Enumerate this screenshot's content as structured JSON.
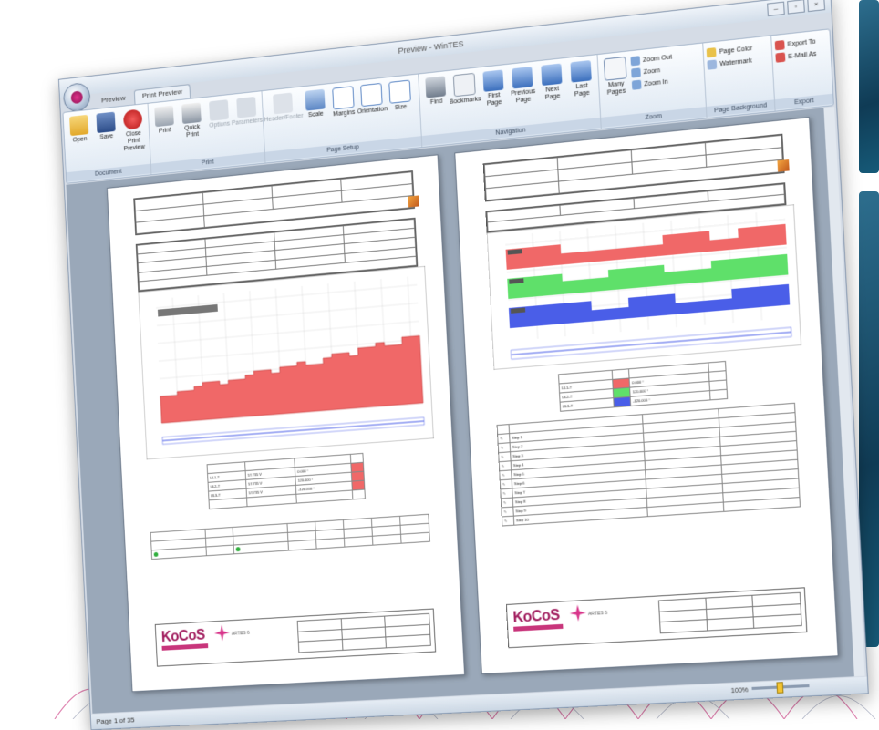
{
  "window": {
    "title": "Preview - WinTES",
    "buttons": [
      "–",
      "▫",
      "×"
    ]
  },
  "ribbon": {
    "tabs": [
      "Preview",
      "Print Preview"
    ],
    "groups": [
      {
        "label": "Document",
        "buttons": [
          "Open",
          "Save",
          "Close Print Preview"
        ]
      },
      {
        "label": "Print",
        "buttons": [
          "Print",
          "Quick Print",
          "Options",
          "Parameters"
        ]
      },
      {
        "label": "Page Setup",
        "buttons": [
          "Header/Footer",
          "Scale",
          "Margins",
          "Orientation",
          "Size"
        ]
      },
      {
        "label": "Navigation",
        "buttons": [
          "Find",
          "Bookmarks",
          "First Page",
          "Previous Page",
          "Next Page",
          "Last Page"
        ]
      },
      {
        "label": "Zoom",
        "buttons": [
          "Many Pages",
          "Zoom Out",
          "Zoom",
          "Zoom In"
        ]
      },
      {
        "label": "Page Background",
        "buttons": [
          "Page Color",
          "Watermark"
        ]
      },
      {
        "label": "Export",
        "buttons": [
          "Export To",
          "E-Mail As"
        ]
      }
    ]
  },
  "status": {
    "page": "Page 1 of 35",
    "zoom": "100%"
  },
  "colors": {
    "red": "#f06868",
    "green": "#5fe06a",
    "blue": "#4a5ee8",
    "brand": "#a01a5c"
  },
  "page_left": {
    "signals": [
      {
        "name": "UL1-T",
        "value": "57.735 V",
        "angle": "0.000 °"
      },
      {
        "name": "UL2-T",
        "value": "57.735 V",
        "angle": "120.000 °"
      },
      {
        "name": "UL3-T",
        "value": "57.735 V",
        "angle": "-120.000 °"
      }
    ]
  },
  "page_right": {
    "rows": [
      "Step 1",
      "Step 2",
      "Step 3",
      "Step 4",
      "Step 5",
      "Step 6",
      "Step 7",
      "Step 8",
      "Step 9",
      "Step 10"
    ]
  },
  "logo": {
    "name": "KoCoS",
    "sub": "ARTES 6"
  }
}
